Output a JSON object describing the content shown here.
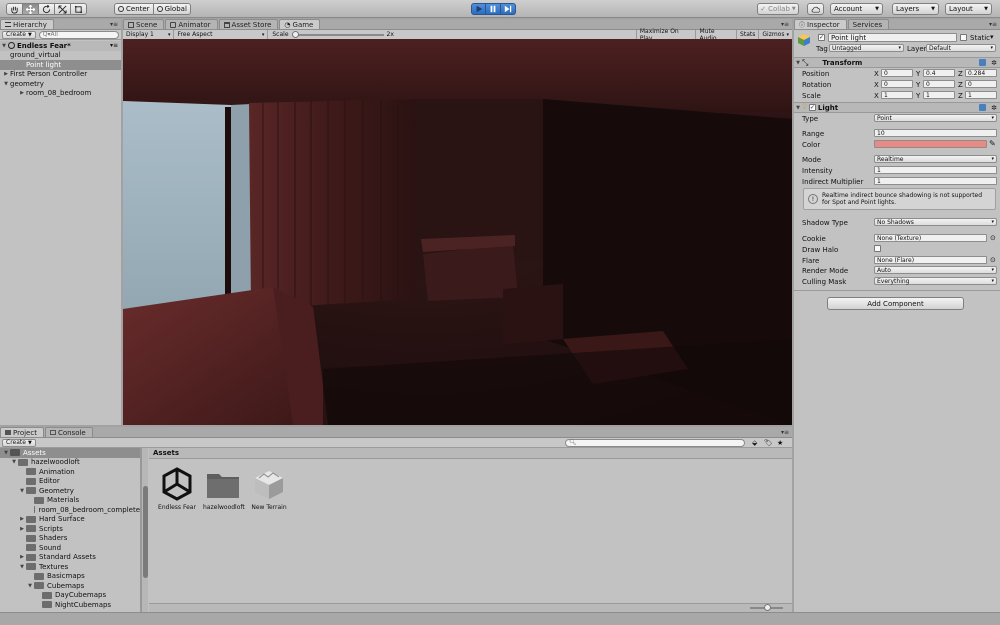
{
  "toolbar": {
    "pivot": "Center",
    "space": "Global",
    "collab": "Collab",
    "account": "Account",
    "layers": "Layers",
    "layout": "Layout"
  },
  "hierarchy": {
    "tab": "Hierarchy",
    "create": "Create",
    "search_placeholder": "Q▾All",
    "scene": "Endless Fear*",
    "items": [
      {
        "label": "ground_virtual"
      },
      {
        "label": "Point light"
      },
      {
        "label": "First Person Controller"
      },
      {
        "label": "geometry"
      },
      {
        "label": "room_08_bedroom"
      }
    ]
  },
  "center_tabs": {
    "scene": "Scene",
    "animator": "Animator",
    "asset_store": "Asset Store",
    "game": "Game"
  },
  "game_bar": {
    "display": "Display 1",
    "aspect": "Free Aspect",
    "scale_label": "Scale",
    "scale_value": "2x",
    "maximize": "Maximize On Play",
    "mute": "Mute Audio",
    "stats": "Stats",
    "gizmos": "Gizmos"
  },
  "inspector": {
    "tab": "Inspector",
    "services_tab": "Services",
    "object_name": "Point light",
    "static_label": "Static",
    "tag_label": "Tag",
    "tag_value": "Untagged",
    "layer_label": "Layer",
    "layer_value": "Default",
    "transform": {
      "title": "Transform",
      "position_label": "Position",
      "rotation_label": "Rotation",
      "scale_label": "Scale",
      "position": {
        "x": "0",
        "y": "0.4",
        "z": "0.284"
      },
      "rotation": {
        "x": "0",
        "y": "0",
        "z": "0"
      },
      "scale": {
        "x": "1",
        "y": "1",
        "z": "1"
      }
    },
    "light": {
      "title": "Light",
      "type_label": "Type",
      "type_value": "Point",
      "range_label": "Range",
      "range_value": "10",
      "color_label": "Color",
      "color_value": "#e88b85",
      "mode_label": "Mode",
      "mode_value": "Realtime",
      "intensity_label": "Intensity",
      "intensity_value": "1",
      "indirect_label": "Indirect Multiplier",
      "indirect_value": "1",
      "help_text": "Realtime indirect bounce shadowing is not supported for Spot and Point lights.",
      "shadow_label": "Shadow Type",
      "shadow_value": "No Shadows",
      "cookie_label": "Cookie",
      "cookie_value": "None (Texture)",
      "halo_label": "Draw Halo",
      "flare_label": "Flare",
      "flare_value": "None (Flare)",
      "render_label": "Render Mode",
      "render_value": "Auto",
      "culling_label": "Culling Mask",
      "culling_value": "Everything"
    },
    "add_component": "Add Component"
  },
  "project": {
    "tab": "Project",
    "console_tab": "Console",
    "create": "Create",
    "breadcrumb": "Assets",
    "tree": [
      {
        "label": "Assets"
      },
      {
        "label": "hazelwoodloft"
      },
      {
        "label": "Animation"
      },
      {
        "label": "Editor"
      },
      {
        "label": "Geometry"
      },
      {
        "label": "Materials"
      },
      {
        "label": "room_08_bedroom_complete"
      },
      {
        "label": "Hard Surface"
      },
      {
        "label": "Scripts"
      },
      {
        "label": "Shaders"
      },
      {
        "label": "Sound"
      },
      {
        "label": "Standard Assets"
      },
      {
        "label": "Textures"
      },
      {
        "label": "Basicmaps"
      },
      {
        "label": "Cubemaps"
      },
      {
        "label": "DayCubemaps"
      },
      {
        "label": "NightCubemaps"
      }
    ],
    "assets": [
      {
        "label": "Endless Fear"
      },
      {
        "label": "hazelwoodloft"
      },
      {
        "label": "New Terrain"
      }
    ]
  }
}
